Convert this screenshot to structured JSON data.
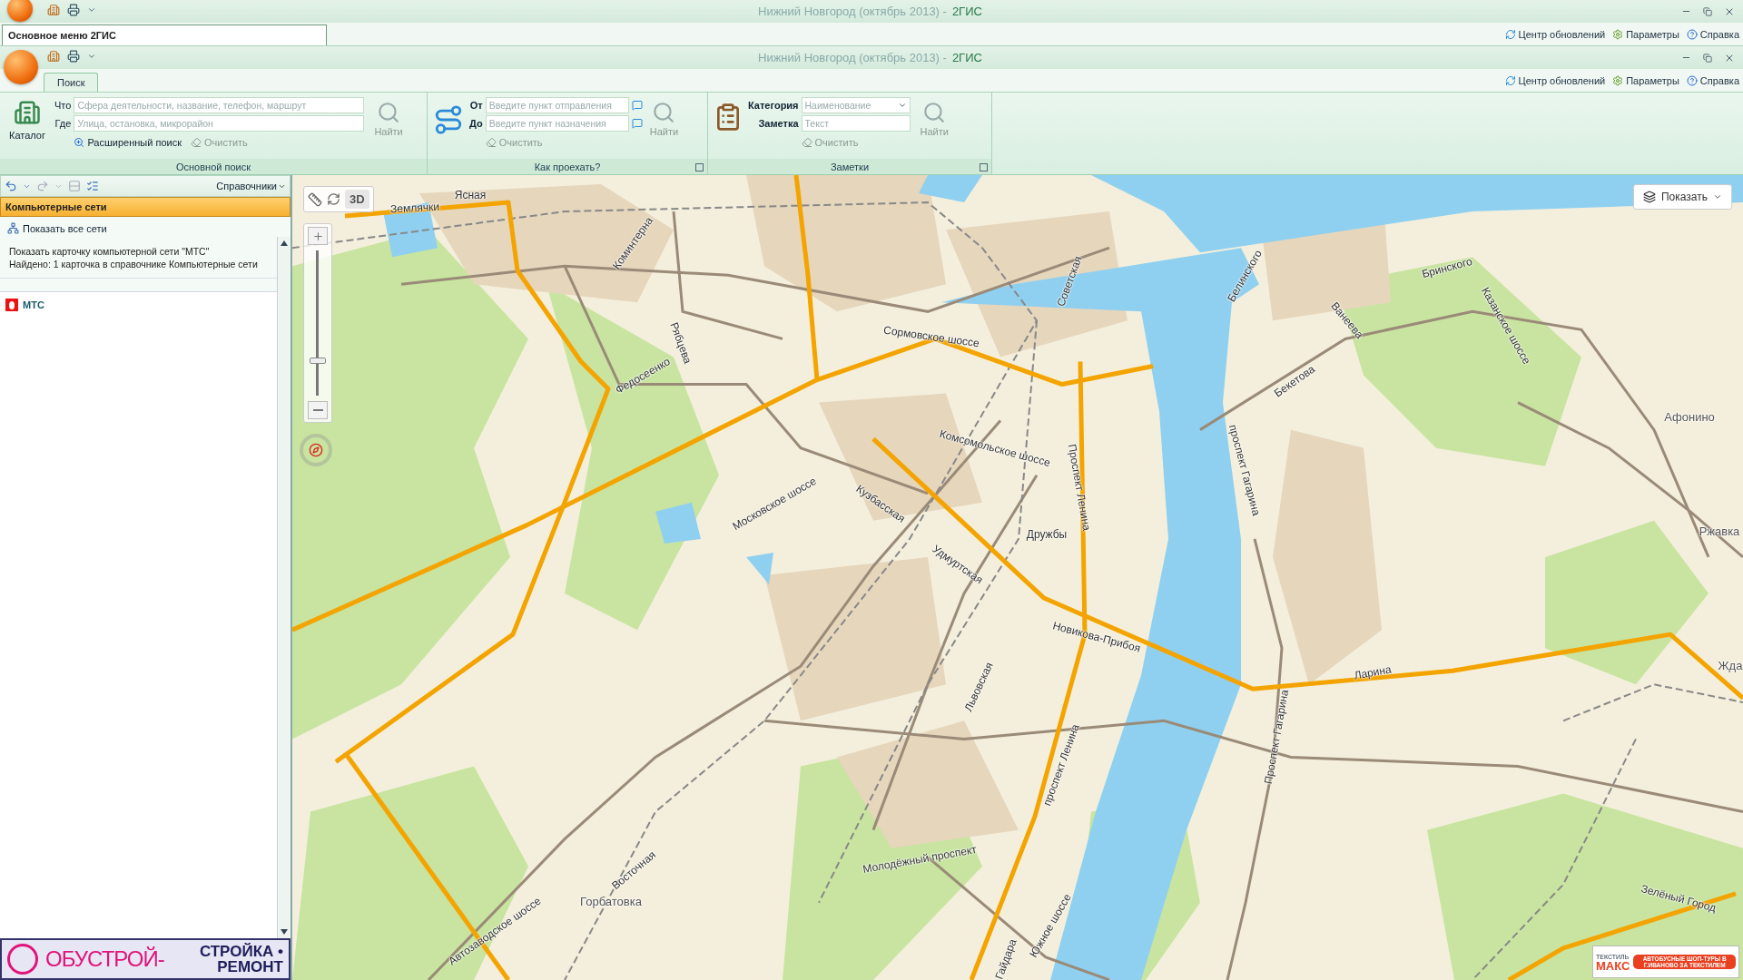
{
  "outer_window": {
    "title": "Нижний Новгород (октябрь 2013) -",
    "app_name": "2ГИС",
    "menu_tab": "Основное меню 2ГИС",
    "links": [
      {
        "label": "Центр обновлений",
        "kind": "update"
      },
      {
        "label": "Параметры",
        "kind": "settings"
      },
      {
        "label": "Справка",
        "kind": "help"
      }
    ]
  },
  "window": {
    "title": "Нижний Новгород (октябрь 2013) -",
    "app_name": "2ГИС",
    "tabs": [
      {
        "label": "Поиск",
        "selected": true
      }
    ],
    "links": [
      {
        "label": "Центр обновлений",
        "kind": "update"
      },
      {
        "label": "Параметры",
        "kind": "settings"
      },
      {
        "label": "Справка",
        "kind": "help"
      }
    ]
  },
  "ribbon": {
    "groups": [
      {
        "kind": "search",
        "caption": "Основной поиск",
        "big_button": "Каталог",
        "fields": [
          {
            "label": "Что",
            "placeholder": "Сфера деятельности, название, телефон, маршрут"
          },
          {
            "label": "Где",
            "placeholder": "Улица, остановка, микрорайон"
          }
        ],
        "find_button": {
          "label": "Найти",
          "disabled": true
        },
        "advanced_link": "Расширенный поиск",
        "clear_button": {
          "label": "Очистить",
          "disabled": true
        }
      },
      {
        "kind": "route",
        "caption": "Как проехать?",
        "fields": [
          {
            "label": "От",
            "placeholder": "Введите пункт отправления"
          },
          {
            "label": "До",
            "placeholder": "Введите пункт назначения"
          }
        ],
        "find_button": {
          "label": "Найти",
          "disabled": true
        },
        "clear_button": {
          "label": "Очистить",
          "disabled": true
        }
      },
      {
        "kind": "notes",
        "caption": "Заметки",
        "fields": [
          {
            "label": "Категория",
            "value": "Наименование"
          },
          {
            "label": "Заметка",
            "placeholder": "Текст"
          }
        ],
        "find_button": {
          "label": "Найти",
          "disabled": true
        },
        "clear_button": {
          "label": "Очистить",
          "disabled": true
        }
      }
    ]
  },
  "left_panel": {
    "toolbar": {
      "back": {
        "disabled": false
      },
      "forward": {
        "disabled": true
      },
      "directories_menu": "Справочники"
    },
    "header": "Компьютерные сети",
    "show_all": "Показать все сети",
    "info": [
      "Показать карточку компьютерной сети \"МТС\"",
      "Найдено: 1 карточка в справочнике Компьютерные сети"
    ],
    "results": [
      {
        "name": "МТС",
        "selected": false
      }
    ],
    "ad": [
      "ОБУСТРОЙ-",
      "СТРОЙКА •",
      "РЕМОНТ"
    ]
  },
  "map": {
    "view_3d": "3D",
    "zoom": {
      "level": 0.23
    },
    "layers_button": "Показать",
    "labels": [
      {
        "text": "Землячки",
        "kind": "street"
      },
      {
        "text": "Ясная",
        "kind": "street"
      },
      {
        "text": "Коминтерна",
        "kind": "street"
      },
      {
        "text": "Сормовское шоссе",
        "kind": "street"
      },
      {
        "text": "Федосеенко",
        "kind": "street"
      },
      {
        "text": "Рябцева",
        "kind": "street"
      },
      {
        "text": "Комсомольское шоссе",
        "kind": "street"
      },
      {
        "text": "Советская",
        "kind": "street"
      },
      {
        "text": "Проспект Ленина",
        "kind": "street"
      },
      {
        "text": "Московское шоссе",
        "kind": "street"
      },
      {
        "text": "Кузбасская",
        "kind": "street"
      },
      {
        "text": "Удмуртская",
        "kind": "street"
      },
      {
        "text": "Дружбы",
        "kind": "street"
      },
      {
        "text": "Новикова-Прибоя",
        "kind": "street"
      },
      {
        "text": "Ларина",
        "kind": "street"
      },
      {
        "text": "Белинского",
        "kind": "street"
      },
      {
        "text": "Ванеева",
        "kind": "street"
      },
      {
        "text": "Бринского",
        "kind": "street"
      },
      {
        "text": "Казанское шоссе",
        "kind": "street"
      },
      {
        "text": "Бекетова",
        "kind": "street"
      },
      {
        "text": "проспект Гагарина",
        "kind": "street"
      },
      {
        "text": "Афонино",
        "kind": "place"
      },
      {
        "text": "Ржавка",
        "kind": "place"
      },
      {
        "text": "Жда",
        "kind": "place"
      },
      {
        "text": "Проспект Гагарина",
        "kind": "street"
      },
      {
        "text": "Львовская",
        "kind": "street"
      },
      {
        "text": "проспект Ленина",
        "kind": "street"
      },
      {
        "text": "Молодёжный проспект",
        "kind": "street"
      },
      {
        "text": "Горбатовка",
        "kind": "place"
      },
      {
        "text": "Восточная",
        "kind": "street"
      },
      {
        "text": "Автозаводское шоссе",
        "kind": "street"
      },
      {
        "text": "Южное шоссе",
        "kind": "street"
      },
      {
        "text": "Гайдара",
        "kind": "street"
      },
      {
        "text": "Зелёный Город",
        "kind": "street"
      }
    ],
    "ad": {
      "brand": [
        "ТЕКСТИЛЬ",
        "МАКС"
      ],
      "text": "АВТОБУСНЫЕ ШОП-ТУРЫ В Г.ИВАНОВО ЗА ТЕКСТИЛЕМ"
    }
  }
}
